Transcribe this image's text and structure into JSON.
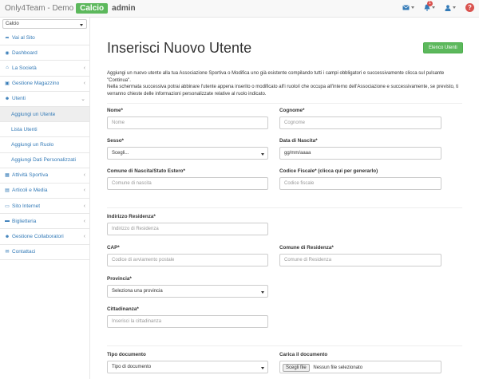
{
  "topbar": {
    "brand_prefix": "Only4Team - Demo",
    "brand_badge": "Calcio",
    "brand_suffix": "admin",
    "notifications_count": "1",
    "help_label": "?"
  },
  "sidebar": {
    "selector_value": "Calcio",
    "items": [
      {
        "label": "Vai al Sito"
      },
      {
        "label": "Dashboard"
      },
      {
        "label": "La Società"
      },
      {
        "label": "Gestione Magazzino"
      },
      {
        "label": "Utenti"
      },
      {
        "label": "Aggiungi un Utente"
      },
      {
        "label": "Lista Utenti"
      },
      {
        "label": "Aggiungi un Ruolo"
      },
      {
        "label": "Aggiungi Dati Personalizzati"
      },
      {
        "label": "Attività Sportiva"
      },
      {
        "label": "Articoli e Media"
      },
      {
        "label": "Sito Internet"
      },
      {
        "label": "Biglietteria"
      },
      {
        "label": "Gestione Collaboratori"
      },
      {
        "label": "Contattaci"
      }
    ]
  },
  "main": {
    "title": "Inserisci Nuovo Utente",
    "list_button": "Elenco Utenti",
    "intro_1": "Aggiungi un nuovo utente alla tua Associazione Sportiva o Modifica uno già esistente compilando tutti i campi obbligatori e successivamente clicca sul pulsante \"Continua\".",
    "intro_2": "Nella schermata successiva potrai abbinare l'utente appena inserito o modificato all'i ruolo/i che occupa all'interno dell'Associazione e successivamente, se previsto, ti verranno chieste delle informazioni personalizzate relative al ruolo indicato.",
    "form": {
      "nome_label": "Nome*",
      "nome_placeholder": "Nome",
      "cognome_label": "Cognome*",
      "cognome_placeholder": "Cognome",
      "sesso_label": "Sesso*",
      "sesso_value": "Scegli...",
      "nascita_label": "Data di Nascita*",
      "nascita_placeholder": "gg/mm/aaaa",
      "comune_nascita_label": "Comune di Nascita/Stato Estero*",
      "comune_nascita_placeholder": "Comune di nascita",
      "cf_label": "Codice Fiscale* (clicca qui per generarlo)",
      "cf_placeholder": "Codice fiscale",
      "indirizzo_label": "Indirizzo Residenza*",
      "indirizzo_placeholder": "Indirizzo di Residenza",
      "cap_label": "CAP*",
      "cap_placeholder": "Codice di avviamento postale",
      "comune_res_label": "Comune di Residenza*",
      "comune_res_placeholder": "Comune di Residenza",
      "provincia_label": "Provincia*",
      "provincia_value": "Seleziona una provincia",
      "cittadinanza_label": "Cittadinanza*",
      "cittadinanza_placeholder": "Inserisci la cittadinanza",
      "tipo_doc_label": "Tipo documento",
      "tipo_doc_value": "Tipo di documento",
      "carica_label": "Carica il documento",
      "file_button": "Scegli file",
      "file_status": "Nessun file selezionato"
    }
  },
  "colors": {
    "accent_green": "#5cb85c",
    "link_blue": "#337ab7",
    "alert_red": "#d9534f"
  },
  "icons": [
    "share-icon",
    "dashboard-icon",
    "home-icon",
    "archive-icon",
    "users-icon",
    "table-icon",
    "newspaper-icon",
    "desktop-icon",
    "ticket-icon",
    "collaborators-icon",
    "contact-icon",
    "envelope-icon",
    "bell-icon",
    "user-icon",
    "help-icon"
  ]
}
